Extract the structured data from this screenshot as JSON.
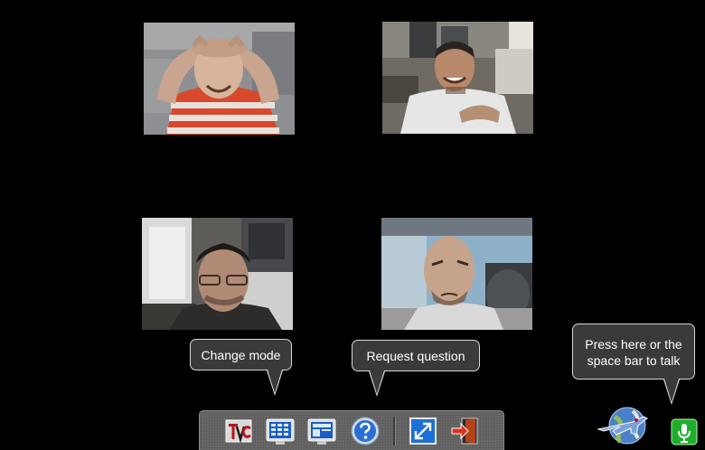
{
  "tiles": [
    {
      "participant": "participant-1"
    },
    {
      "participant": "participant-2"
    },
    {
      "participant": "participant-3"
    },
    {
      "participant": "participant-4"
    }
  ],
  "tooltips": {
    "change_mode": "Change mode",
    "request_question": "Request question",
    "talk_line1": "Press here or the",
    "talk_line2": "space bar to talk"
  },
  "toolbar": {
    "buttons": [
      {
        "name": "tvc-logo-button",
        "icon": "tvc-icon"
      },
      {
        "name": "grid-layout-button",
        "icon": "grid-layout-icon"
      },
      {
        "name": "single-layout-button",
        "icon": "presentation-layout-icon"
      },
      {
        "name": "request-question-button",
        "icon": "question-icon"
      },
      {
        "name": "fullscreen-button",
        "icon": "expand-icon"
      },
      {
        "name": "exit-button",
        "icon": "exit-door-icon"
      }
    ]
  },
  "colors": {
    "background": "#000000",
    "bubble_bg": "#3a3a3a",
    "bubble_border": "#d8d8d8",
    "toolbar_bg": "#6a6a6a",
    "mic_green": "#1fae2b",
    "question_blue": "#2a6fd1"
  }
}
